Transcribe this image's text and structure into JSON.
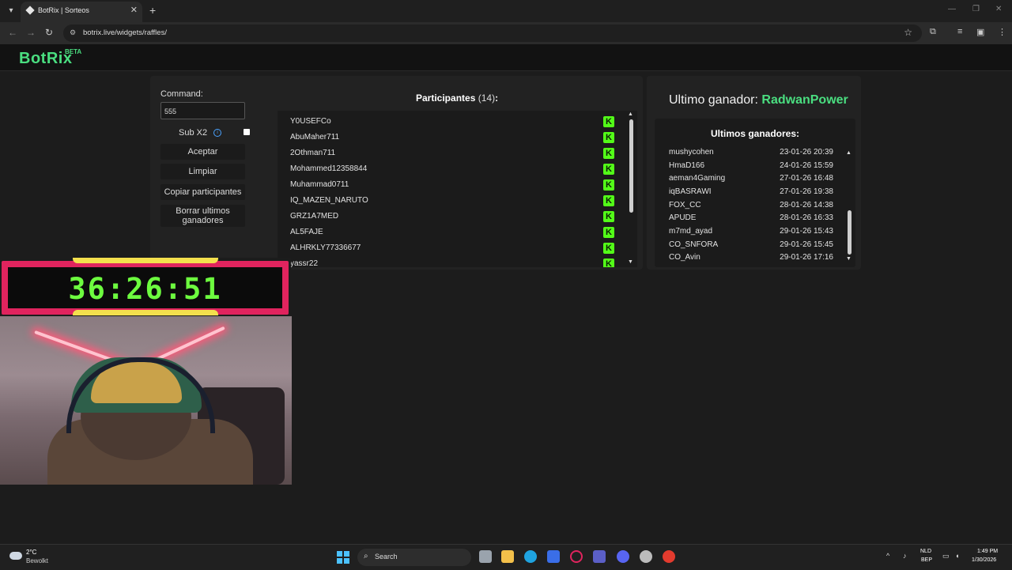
{
  "browser": {
    "tab_title": "BotRix | Sorteos",
    "url": "botrix.live/widgets/raffles/"
  },
  "brand": {
    "name": "BotRix",
    "badge": "BETA"
  },
  "controls": {
    "command_label": "Command:",
    "command_value": "555",
    "subx2_label": "Sub X2",
    "subx2_checked": false,
    "accept_label": "Aceptar",
    "clear_label": "Limpiar",
    "copy_label": "Copiar participantes",
    "delete_winners_label": "Borrar ultimos ganadores"
  },
  "participants": {
    "title": "Participantes",
    "count": "(14)",
    "colon": ":",
    "platform_icon": "kick-icon",
    "items": [
      "Y0USEFCo",
      "AbuMaher711",
      "2Othman711",
      "Mohammed12358844",
      "Muhammad0711",
      "IQ_MAZEN_NARUTO",
      "GRZ1A7MED",
      "AL5FAJE",
      "ALHRKLY77336677",
      "yassr22"
    ]
  },
  "last_winner": {
    "label": "Ultimo ganador:",
    "name": "RadwanPower"
  },
  "recent_winners": {
    "title": "Ultimos ganadores:",
    "items": [
      {
        "name": "mushycohen",
        "date": "23-01-26 20:39"
      },
      {
        "name": "HmaD166",
        "date": "24-01-26 15:59"
      },
      {
        "name": "aeman4Gaming",
        "date": "27-01-26 16:48"
      },
      {
        "name": "iqBASRAWI",
        "date": "27-01-26 19:38"
      },
      {
        "name": "FOX_CC",
        "date": "28-01-26 14:38"
      },
      {
        "name": "APUDE",
        "date": "28-01-26 16:33"
      },
      {
        "name": "m7md_ayad",
        "date": "29-01-26 15:43"
      },
      {
        "name": "CO_SNFORA",
        "date": "29-01-26 15:45"
      },
      {
        "name": "CO_Avin",
        "date": "29-01-26 17:16"
      }
    ]
  },
  "timer": {
    "value": "36:26:51",
    "color": "#6dfb3f",
    "frame_color": "#e0245e",
    "accent": "#f4e04d"
  },
  "taskbar": {
    "weather_temp": "2°C",
    "weather_desc": "Bewolkt",
    "search_placeholder": "Search",
    "lang_line1": "NLD",
    "lang_line2": "BEP",
    "time": "1:49 PM",
    "date": "1/30/2026"
  },
  "colors": {
    "accent_green": "#4ade80",
    "kick_green": "#53fc18"
  }
}
